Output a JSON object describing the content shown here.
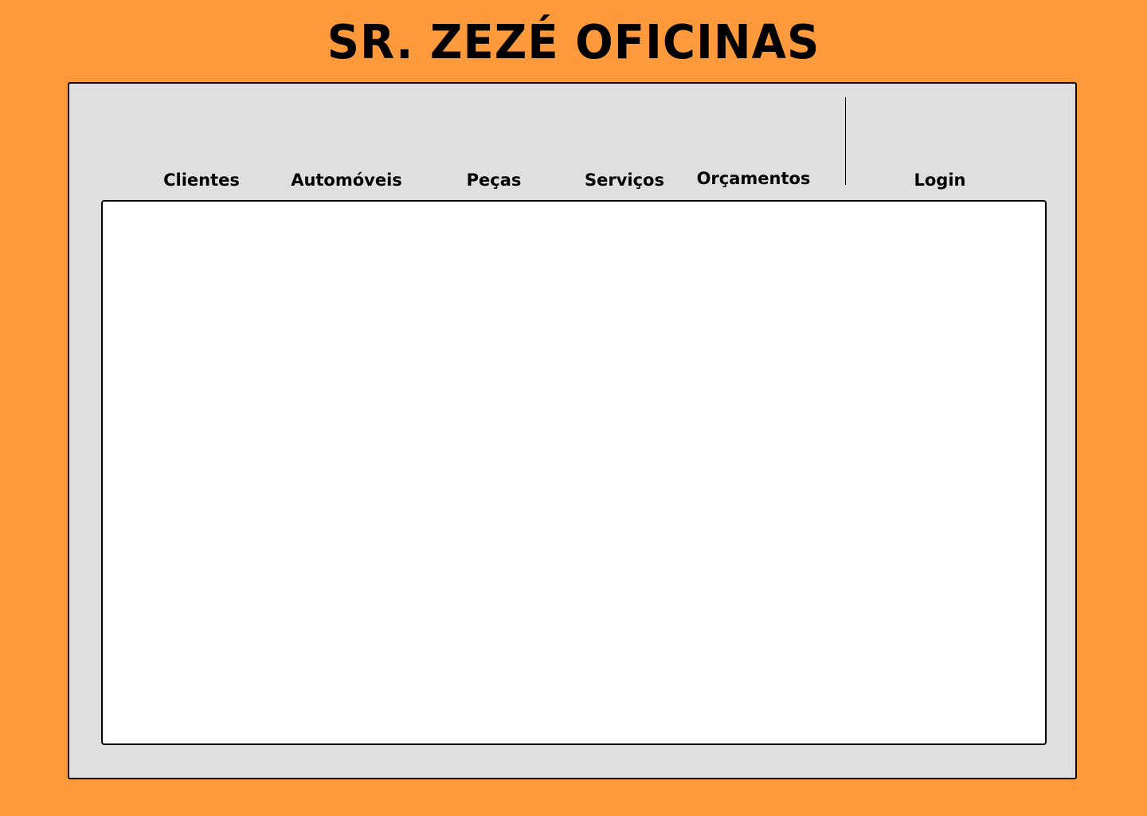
{
  "app": {
    "title": "SR. ZEZÉ OFICINAS"
  },
  "nav": {
    "items": [
      {
        "label": "Clientes"
      },
      {
        "label": "Automóveis"
      },
      {
        "label": "Peças"
      },
      {
        "label": "Serviços"
      },
      {
        "label": "Orçamentos"
      }
    ],
    "login_label": "Login"
  },
  "colors": {
    "background": "#FF9A3C",
    "panel": "#DFDFDF",
    "content": "#FFFFFF",
    "text": "#000000"
  }
}
